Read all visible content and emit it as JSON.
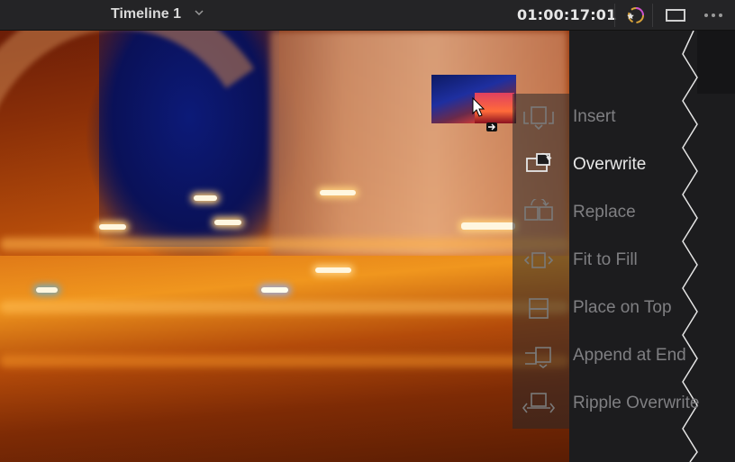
{
  "topbar": {
    "timeline_title": "Timeline 1",
    "timecode": "01:00:17:01",
    "icons": [
      "chevron-down-icon",
      "color-effects-icon",
      "viewer-mode-icon",
      "more-options-icon"
    ]
  },
  "overlay": {
    "items": [
      {
        "label": "Insert",
        "icon": "insert-icon",
        "active": false
      },
      {
        "label": "Overwrite",
        "icon": "overwrite-icon",
        "active": true
      },
      {
        "label": "Replace",
        "icon": "replace-icon",
        "active": false
      },
      {
        "label": "Fit to Fill",
        "icon": "fit-to-fill-icon",
        "active": false
      },
      {
        "label": "Place on Top",
        "icon": "place-on-top-icon",
        "active": false
      },
      {
        "label": "Append at End",
        "icon": "append-at-end-icon",
        "active": false
      },
      {
        "label": "Ripple Overwrite",
        "icon": "ripple-overwrite-icon",
        "active": false
      }
    ]
  },
  "colors": {
    "accent": "#e8e8e8",
    "inactive_label": "#7f7f82",
    "panel_bg": "#1c1c1e",
    "topbar_bg": "#242426"
  }
}
